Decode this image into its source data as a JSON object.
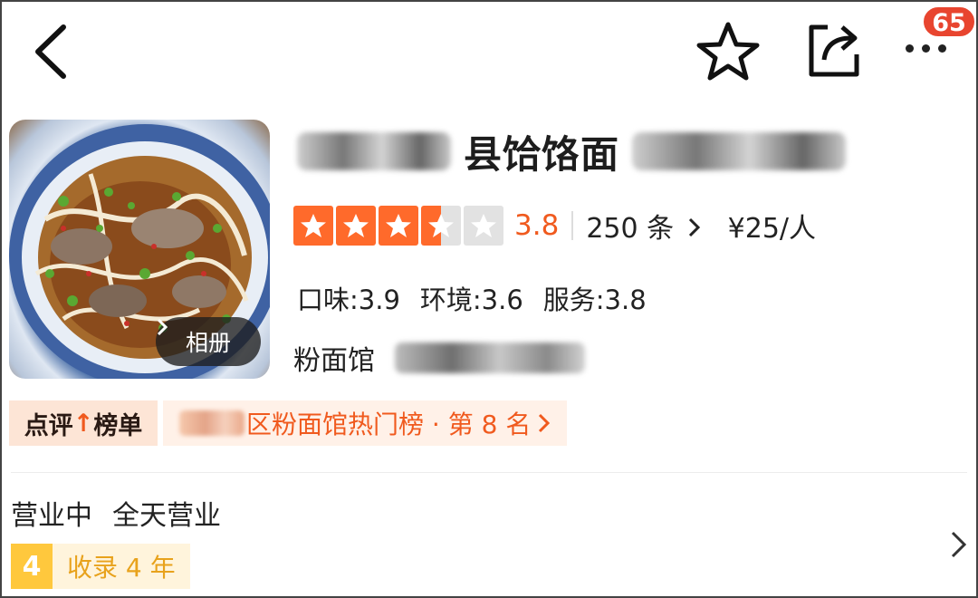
{
  "header": {
    "back_icon": "chevron-left-icon",
    "favorite_icon": "star-outline-icon",
    "share_icon": "share-icon",
    "more_icon": "more-dots-icon",
    "notification_count": "65"
  },
  "shop": {
    "photo_alt": "noodle-bowl-photo",
    "album_label": "相册",
    "title_visible": "县饸饹面",
    "rating": {
      "stars": 3.5,
      "score": "3.8",
      "reviews": "250 条",
      "price": "¥25/人"
    },
    "subscores": {
      "taste": "口味:3.9",
      "environment": "环境:3.6",
      "service": "服务:3.8"
    },
    "category": "粉面馆"
  },
  "ranking": {
    "tag_part1": "点评",
    "tag_part2": "榜单",
    "description": "区粉面馆热门榜 · 第 8 名"
  },
  "hours": {
    "status": "营业中",
    "schedule": "全天营业",
    "years_badge": "4",
    "years_text": "收录 4 年"
  },
  "colors": {
    "accent": "#f05a1e",
    "star": "#ff6a2b",
    "badge": "#e8452f",
    "years": "#ffc83d"
  }
}
